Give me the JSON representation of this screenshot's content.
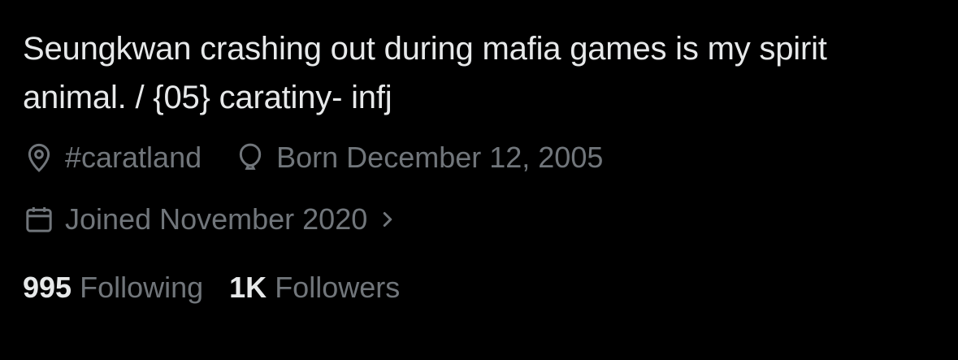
{
  "profile": {
    "bio_line1": "Seungkwan crashing out during mafia games is my spirit",
    "bio_line2": "animal. / {05} caratiny- infj",
    "location": "#caratland",
    "birthday": "Born December 12, 2005",
    "joined": "Joined November 2020",
    "following_count": "995",
    "following_label": "Following",
    "followers_count": "1K",
    "followers_label": "Followers"
  },
  "icons": {
    "location": "location-pin-icon",
    "birthday": "balloon-icon",
    "joined": "calendar-icon",
    "joined_more": "chevron-right-icon"
  },
  "colors": {
    "background": "#000000",
    "primary_text": "#e7e9ea",
    "secondary_text": "#71767b"
  }
}
